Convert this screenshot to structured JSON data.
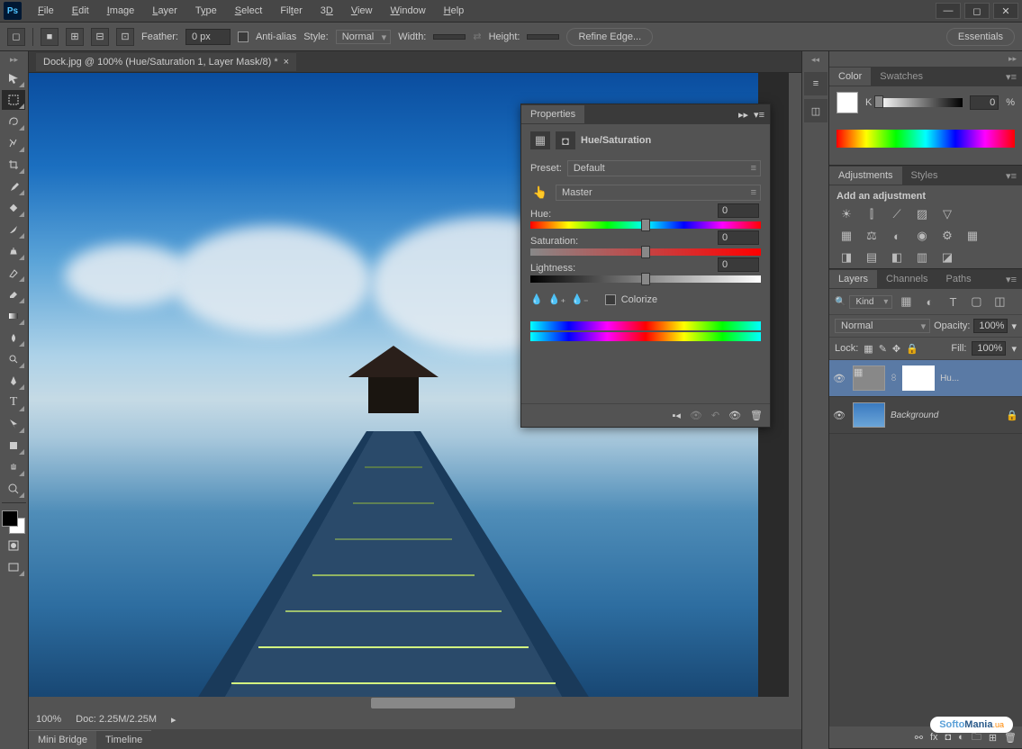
{
  "menubar": [
    "File",
    "Edit",
    "Image",
    "Layer",
    "Type",
    "Select",
    "Filter",
    "3D",
    "View",
    "Window",
    "Help"
  ],
  "options": {
    "feather_label": "Feather:",
    "feather": "0 px",
    "antialias": "Anti-alias",
    "style_label": "Style:",
    "style": "Normal",
    "width_label": "Width:",
    "height_label": "Height:",
    "refine": "Refine Edge...",
    "essentials": "Essentials"
  },
  "doc": {
    "tab": "Dock.jpg @ 100% (Hue/Saturation 1, Layer Mask/8) *",
    "zoom": "100%",
    "docinfo": "Doc: 2.25M/2.25M"
  },
  "bottom_tabs": [
    "Mini Bridge",
    "Timeline"
  ],
  "properties": {
    "title": "Properties",
    "header": "Hue/Saturation",
    "preset_label": "Preset:",
    "preset": "Default",
    "channel": "Master",
    "hue_label": "Hue:",
    "hue": "0",
    "sat_label": "Saturation:",
    "sat": "0",
    "light_label": "Lightness:",
    "light": "0",
    "colorize": "Colorize"
  },
  "color_panel": {
    "tab1": "Color",
    "tab2": "Swatches",
    "k_label": "K",
    "k_value": "0",
    "pct": "%"
  },
  "adjustments": {
    "tab1": "Adjustments",
    "tab2": "Styles",
    "hint": "Add an adjustment"
  },
  "layers": {
    "tab1": "Layers",
    "tab2": "Channels",
    "tab3": "Paths",
    "kind": "Kind",
    "blend": "Normal",
    "opacity_label": "Opacity:",
    "opacity": "100%",
    "lock_label": "Lock:",
    "fill_label": "Fill:",
    "fill": "100%",
    "layer1": "Hu...",
    "layer2": "Background"
  },
  "watermark": "SoftoMania"
}
